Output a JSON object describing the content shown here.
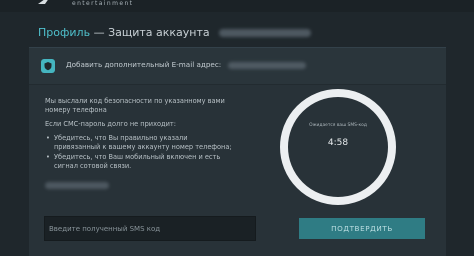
{
  "brand": {
    "subtitle": "entertainment"
  },
  "header": {
    "breadcrumb": "Профиль",
    "separator": "—",
    "page_title": "Защита аккаунта"
  },
  "panel": {
    "add_email_label": "Добавить дополнительный E-mail адрес:",
    "message": {
      "sent": "Мы выслали код безопасности по указанному вами номеру телефона",
      "if_not_received": "Если СМС-пароль долго не приходит:",
      "tips": [
        "Убедитесь, что Вы правильно указали привязанный к вашему аккаунту номер телефона;",
        "Убедитесь, что Ваш мобильный включен и есть сигнал сотовой связи."
      ]
    },
    "timer": {
      "caption": "Ожидается ваш SMS-код",
      "value": "4:58"
    },
    "sms_input": {
      "placeholder": "Введите полученный SMS код",
      "value": ""
    },
    "confirm_button": "ПОДТВЕРДИТЬ"
  },
  "colors": {
    "background": "#1f272c",
    "panel": "#283238",
    "accent": "#4fc0cc",
    "button": "#2f7c84"
  }
}
